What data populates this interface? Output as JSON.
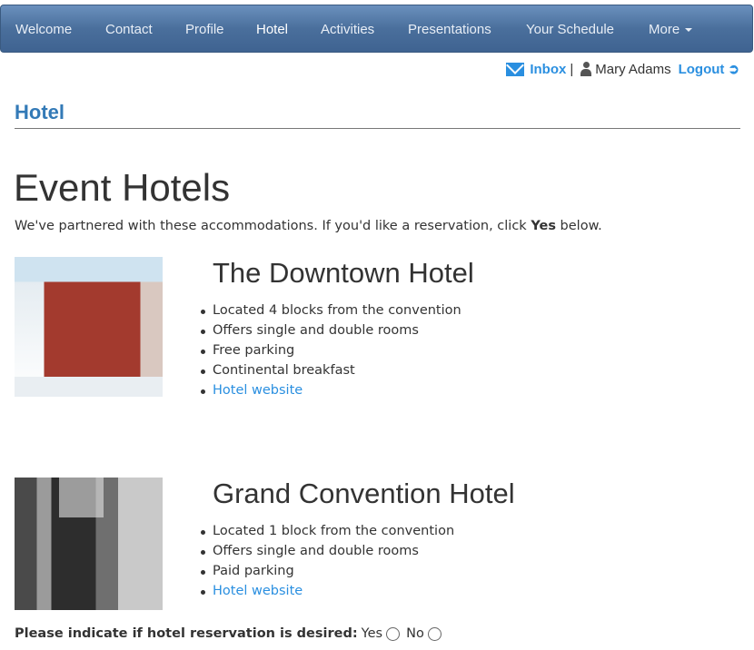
{
  "nav": {
    "items": [
      "Welcome",
      "Contact",
      "Profile",
      "Hotel",
      "Activities",
      "Presentations",
      "Your Schedule",
      "More"
    ],
    "active": "Hotel"
  },
  "userbar": {
    "inbox": "Inbox",
    "separator": "|",
    "user": "Mary Adams",
    "logout": "Logout"
  },
  "section_title": "Hotel",
  "page_title": "Event Hotels",
  "intro": {
    "before": "We've partnered with these accommodations. If you'd like a reservation, click ",
    "bold": "Yes",
    "after": " below."
  },
  "hotels": [
    {
      "name": "The Downtown Hotel",
      "features": [
        "Located 4 blocks from the convention",
        "Offers single and double rooms",
        "Free parking",
        "Continental breakfast"
      ],
      "link": "Hotel website"
    },
    {
      "name": "Grand Convention Hotel",
      "features": [
        "Located 1 block from the convention",
        "Offers single and double rooms",
        "Paid parking"
      ],
      "link": "Hotel website"
    }
  ],
  "reservation": {
    "question": "Please indicate if hotel reservation is desired:",
    "yes": "Yes",
    "no": "No"
  }
}
